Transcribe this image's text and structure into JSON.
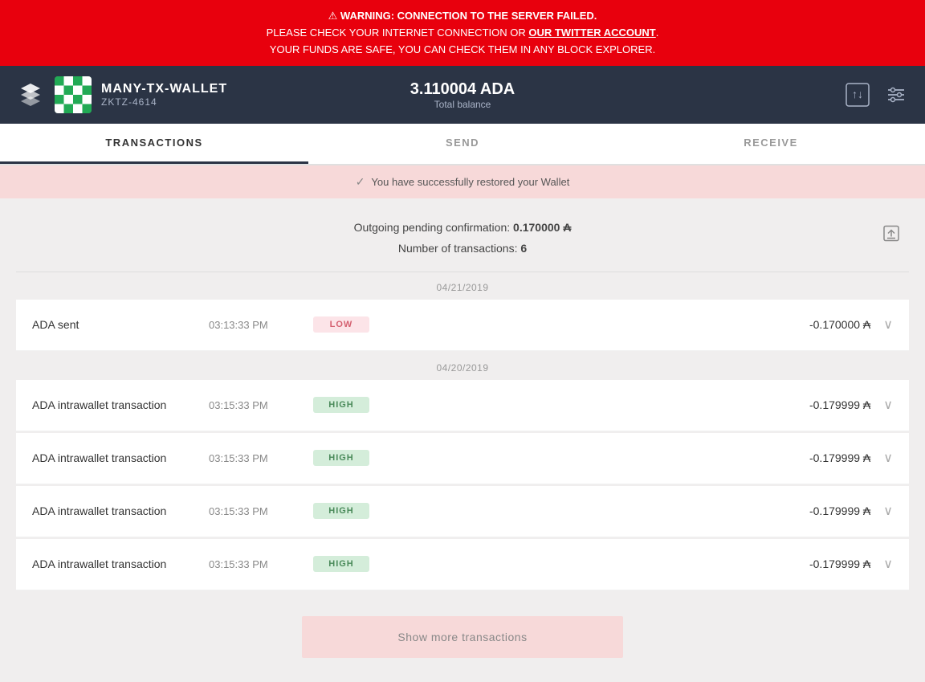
{
  "warning": {
    "icon": "⚠",
    "line1": "WARNING: CONNECTION TO THE SERVER FAILED.",
    "line2_prefix": "PLEASE CHECK YOUR INTERNET CONNECTION OR ",
    "line2_link": "OUR TWITTER ACCOUNT",
    "line2_suffix": ".",
    "line3": "YOUR FUNDS ARE SAFE, YOU CAN CHECK THEM IN ANY BLOCK EXPLORER."
  },
  "header": {
    "wallet_name": "MANY-TX-WALLET",
    "wallet_id": "ZKTZ-4614",
    "balance": "3.110004 ADA",
    "balance_label": "Total balance"
  },
  "nav": {
    "tabs": [
      {
        "label": "TRANSACTIONS",
        "active": true
      },
      {
        "label": "SEND",
        "active": false
      },
      {
        "label": "RECEIVE",
        "active": false
      }
    ]
  },
  "notification": {
    "message": "You have successfully restored your Wallet"
  },
  "summary": {
    "pending_label": "Outgoing pending confirmation:",
    "pending_amount": "0.170000",
    "tx_count_label": "Number of transactions:",
    "tx_count": "6"
  },
  "dates": {
    "date1": "04/21/2019",
    "date2": "04/20/2019"
  },
  "transactions": [
    {
      "title": "ADA sent",
      "time": "03:13:33 PM",
      "badge": "LOW",
      "badge_type": "low",
      "amount": "-0.170000 ₳"
    },
    {
      "title": "ADA intrawallet transaction",
      "time": "03:15:33 PM",
      "badge": "HIGH",
      "badge_type": "high",
      "amount": "-0.179999 ₳"
    },
    {
      "title": "ADA intrawallet transaction",
      "time": "03:15:33 PM",
      "badge": "HIGH",
      "badge_type": "high",
      "amount": "-0.179999 ₳"
    },
    {
      "title": "ADA intrawallet transaction",
      "time": "03:15:33 PM",
      "badge": "HIGH",
      "badge_type": "high",
      "amount": "-0.179999 ₳"
    },
    {
      "title": "ADA intrawallet transaction",
      "time": "03:15:33 PM",
      "badge": "HIGH",
      "badge_type": "high",
      "amount": "-0.179999 ₳"
    }
  ],
  "show_more": {
    "label": "Show more transactions"
  },
  "icons": {
    "logo": "double-chevron",
    "export": "export",
    "settings": "settings",
    "send": "send"
  }
}
